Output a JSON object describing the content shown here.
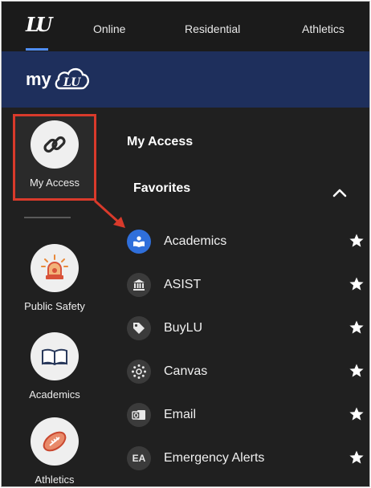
{
  "topnav": {
    "logo": "LU",
    "links": [
      "Online",
      "Residential",
      "Athletics"
    ]
  },
  "banner": {
    "brand": "my",
    "brand_mark": "LU"
  },
  "rail": {
    "items": [
      {
        "label": "My Access",
        "icon": "chain-link-icon",
        "selected": true
      },
      {
        "label": "Public Safety",
        "icon": "siren-icon"
      },
      {
        "label": "Academics",
        "icon": "open-book-icon"
      },
      {
        "label": "Athletics",
        "icon": "football-icon"
      }
    ]
  },
  "panel": {
    "title": "My Access",
    "section": "Favorites",
    "favorites": [
      {
        "label": "Academics",
        "icon": "book-reader-icon",
        "icon_text": "",
        "starred": true
      },
      {
        "label": "ASIST",
        "icon": "bank-icon",
        "icon_text": "",
        "starred": true
      },
      {
        "label": "BuyLU",
        "icon": "tag-icon",
        "icon_text": "",
        "starred": true
      },
      {
        "label": "Canvas",
        "icon": "canvas-icon",
        "icon_text": "",
        "starred": true
      },
      {
        "label": "Email",
        "icon": "outlook-icon",
        "icon_text": "",
        "starred": true
      },
      {
        "label": "Emergency Alerts",
        "icon": "ea-icon",
        "icon_text": "EA",
        "starred": true
      }
    ]
  },
  "colors": {
    "background": "#202020",
    "banner": "#1e2f5c",
    "highlight": "#d93a2b",
    "accent_blue": "#2f6fdb"
  }
}
